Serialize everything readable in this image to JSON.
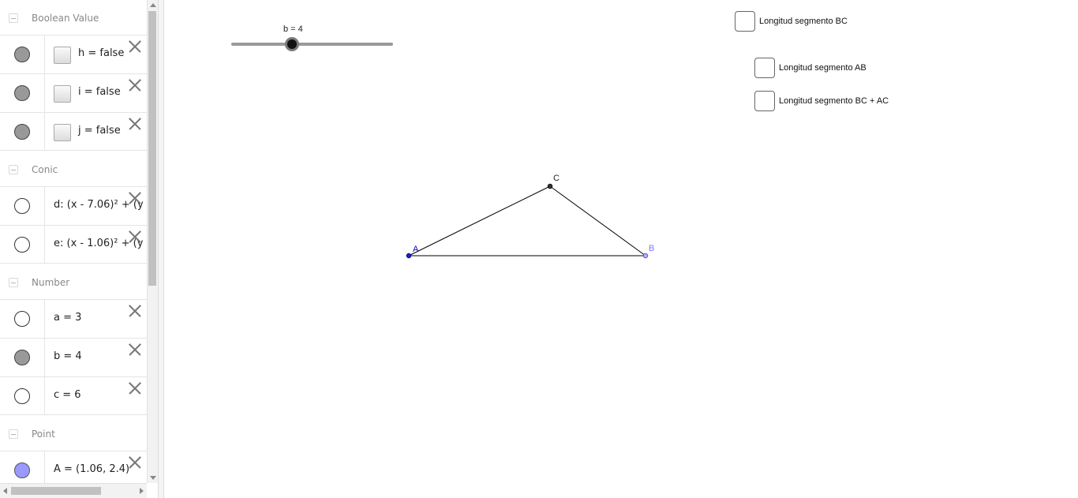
{
  "algebra": {
    "categories": [
      {
        "label": "Boolean Value",
        "items": [
          {
            "name": "h",
            "expr": "h = false",
            "visible": true
          },
          {
            "name": "i",
            "expr": "i = false",
            "visible": true
          },
          {
            "name": "j",
            "expr": "j = false",
            "visible": true
          }
        ]
      },
      {
        "label": "Conic",
        "items": [
          {
            "name": "d",
            "expr": "d: (x - 7.06)² + (y -",
            "visible": false
          },
          {
            "name": "e",
            "expr": "e: (x - 1.06)² + (y -",
            "visible": false
          }
        ]
      },
      {
        "label": "Number",
        "items": [
          {
            "name": "a",
            "expr": "a = 3",
            "visible": false
          },
          {
            "name": "b",
            "expr": "b = 4",
            "visible": true
          },
          {
            "name": "c",
            "expr": "c = 6",
            "visible": false
          }
        ]
      },
      {
        "label": "Point",
        "items": [
          {
            "name": "A",
            "expr": "A = (1.06, 2.4)",
            "visible": true
          }
        ]
      }
    ]
  },
  "graphics": {
    "slider": {
      "label": "b = 4"
    },
    "checkboxes": [
      {
        "label": "Longitud segmento BC",
        "checked": false
      },
      {
        "label": "Longitud segmento AB",
        "checked": false
      },
      {
        "label": "Longitud segmento BC + AC",
        "checked": false
      }
    ],
    "points": [
      {
        "label": "A",
        "color": "#0000cc"
      },
      {
        "label": "B",
        "color": "#7b7bff"
      },
      {
        "label": "C",
        "color": "#222222"
      }
    ]
  }
}
